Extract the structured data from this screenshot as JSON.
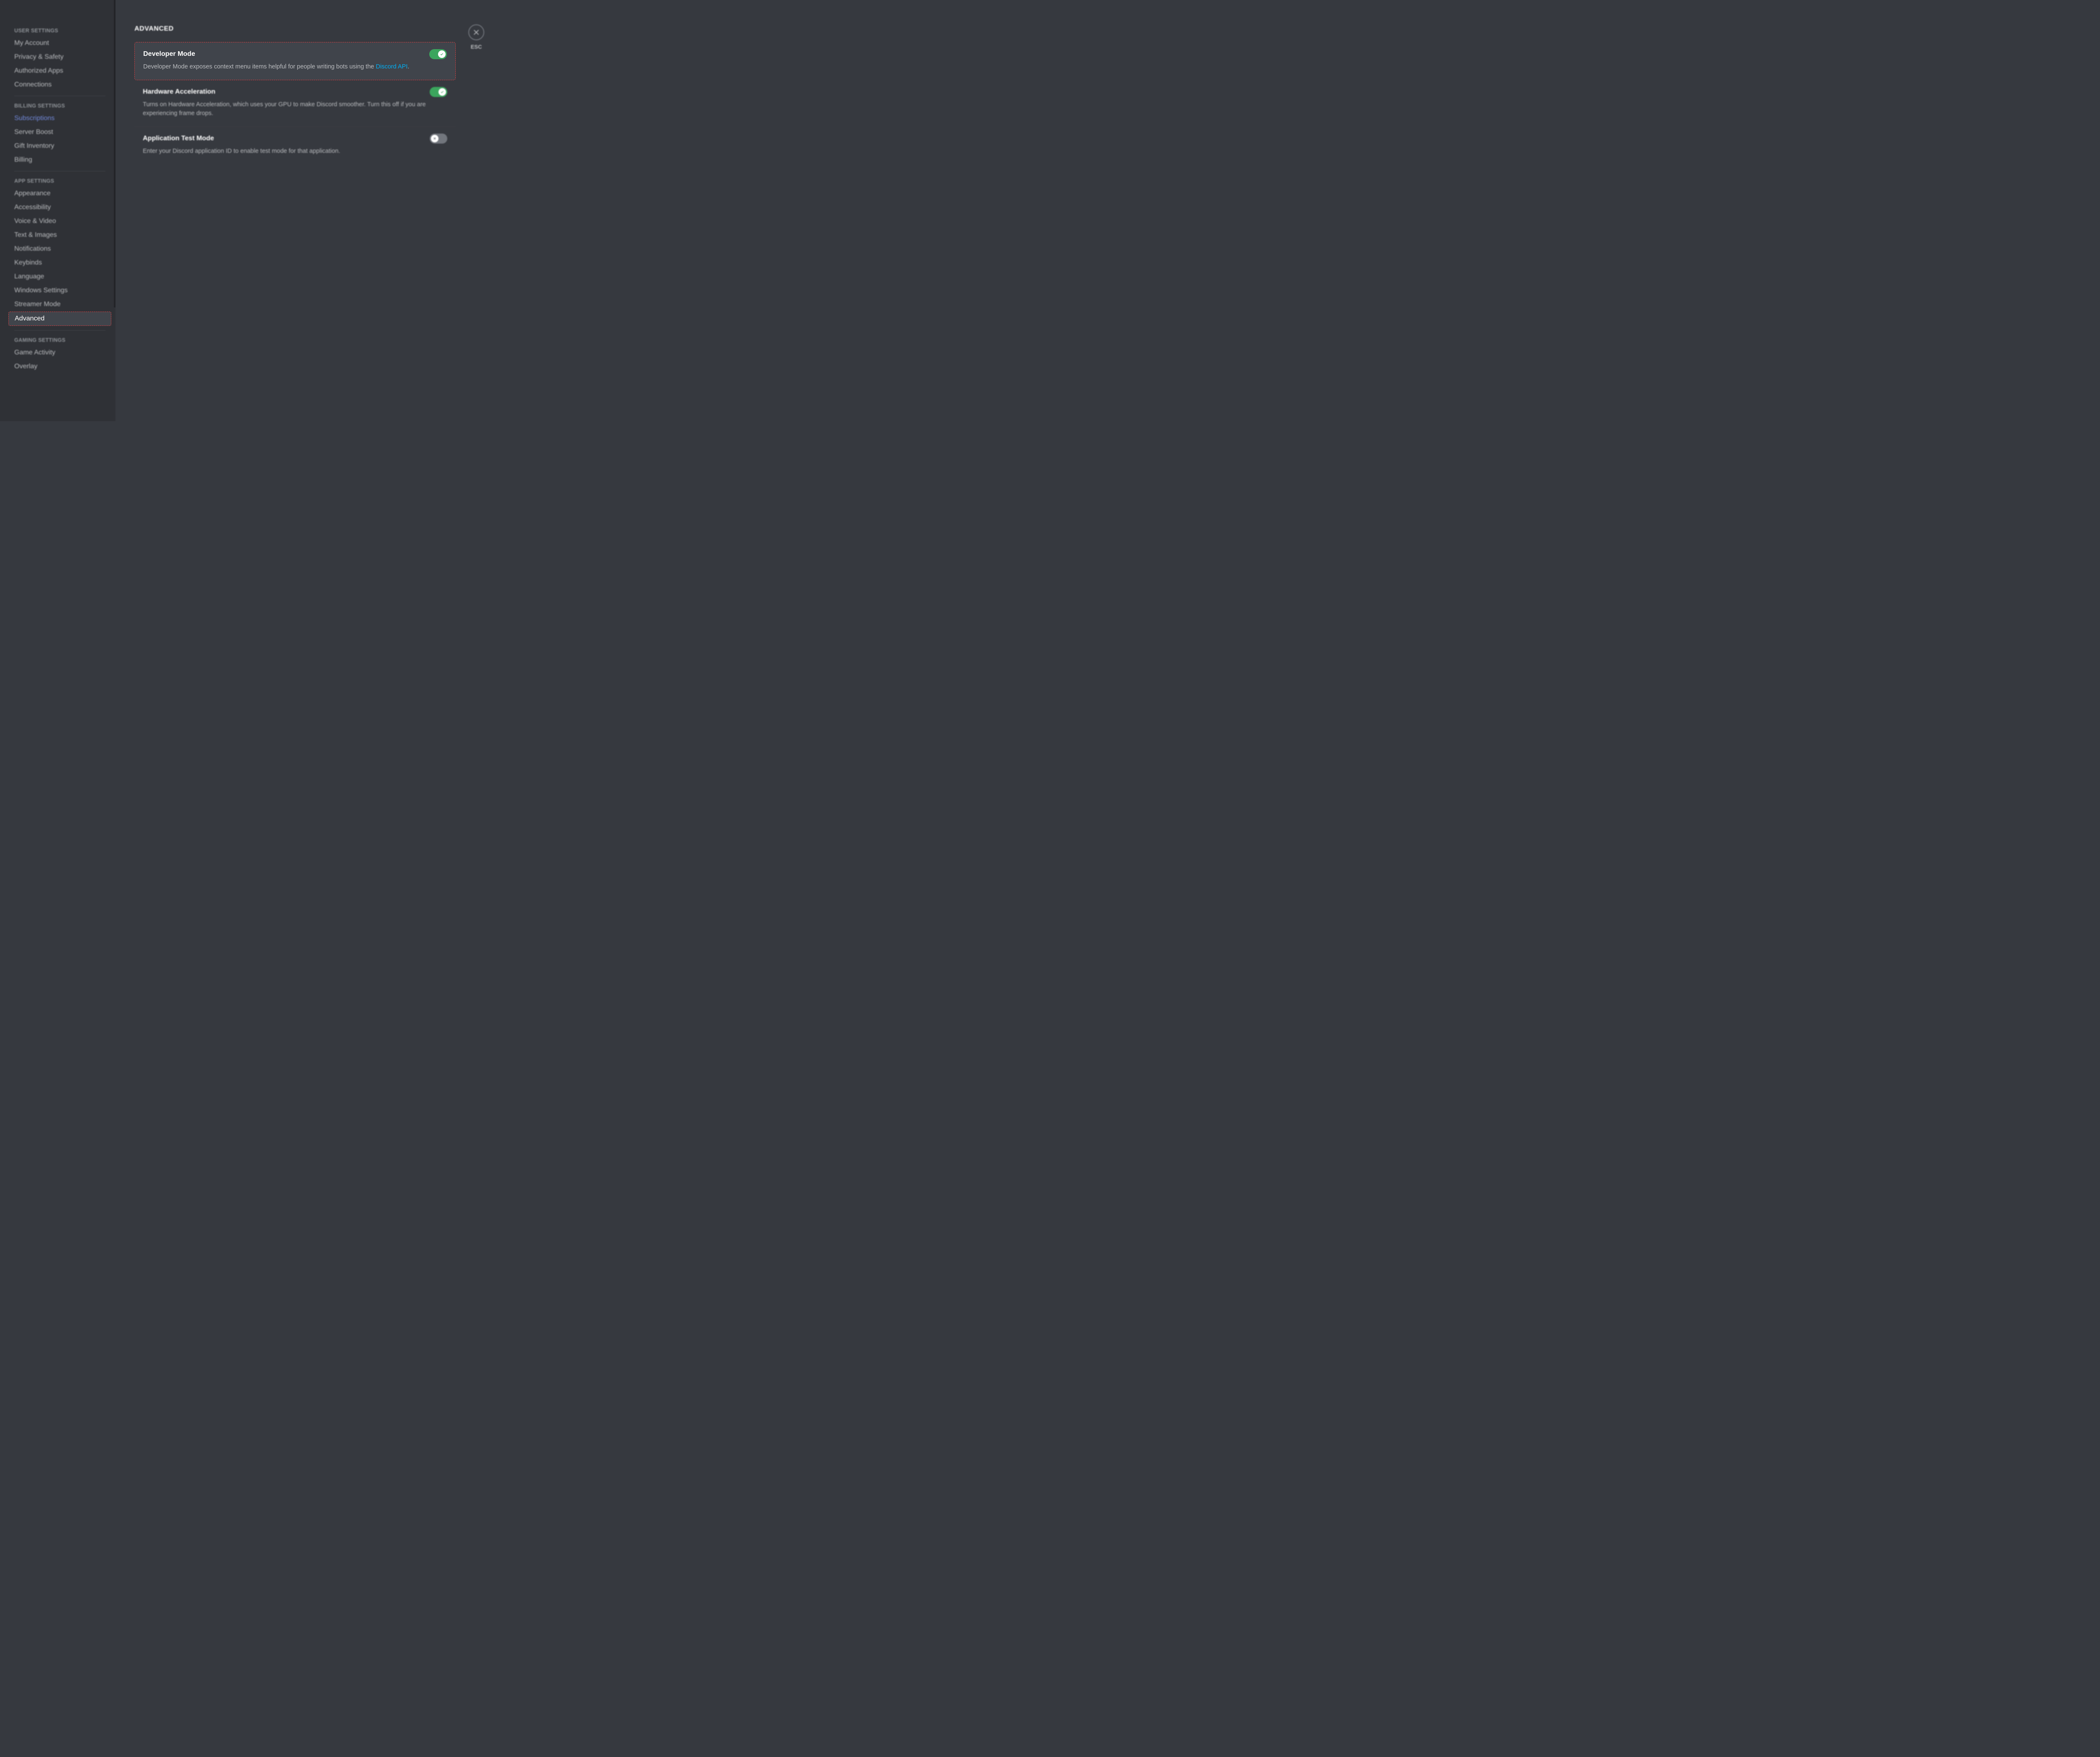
{
  "sidebar": {
    "sections": [
      {
        "header": "USER SETTINGS",
        "items": [
          {
            "label": "My Account",
            "key": "my-account"
          },
          {
            "label": "Privacy & Safety",
            "key": "privacy-safety"
          },
          {
            "label": "Authorized Apps",
            "key": "authorized-apps"
          },
          {
            "label": "Connections",
            "key": "connections"
          }
        ]
      },
      {
        "header": "BILLING SETTINGS",
        "items": [
          {
            "label": "Subscriptions",
            "key": "subscriptions",
            "highlighted": true
          },
          {
            "label": "Server Boost",
            "key": "server-boost"
          },
          {
            "label": "Gift Inventory",
            "key": "gift-inventory"
          },
          {
            "label": "Billing",
            "key": "billing"
          }
        ]
      },
      {
        "header": "APP SETTINGS",
        "items": [
          {
            "label": "Appearance",
            "key": "appearance"
          },
          {
            "label": "Accessibility",
            "key": "accessibility"
          },
          {
            "label": "Voice & Video",
            "key": "voice-video"
          },
          {
            "label": "Text & Images",
            "key": "text-images"
          },
          {
            "label": "Notifications",
            "key": "notifications"
          },
          {
            "label": "Keybinds",
            "key": "keybinds"
          },
          {
            "label": "Language",
            "key": "language"
          },
          {
            "label": "Windows Settings",
            "key": "windows-settings"
          },
          {
            "label": "Streamer Mode",
            "key": "streamer-mode"
          },
          {
            "label": "Advanced",
            "key": "advanced",
            "active": true
          }
        ]
      },
      {
        "header": "GAMING SETTINGS",
        "items": [
          {
            "label": "Game Activity",
            "key": "game-activity"
          },
          {
            "label": "Overlay",
            "key": "overlay"
          }
        ]
      }
    ]
  },
  "close": {
    "label": "ESC"
  },
  "main": {
    "title": "ADVANCED",
    "settings": [
      {
        "key": "developer-mode",
        "title": "Developer Mode",
        "desc_pre": "Developer Mode exposes context menu items helpful for people writing bots using the ",
        "link_text": "Discord API",
        "desc_post": ".",
        "state": "on",
        "emphasis": true
      },
      {
        "key": "hardware-acceleration",
        "title": "Hardware Acceleration",
        "desc": "Turns on Hardware Acceleration, which uses your GPU to make Discord smoother. Turn this off if you are experiencing frame drops.",
        "state": "on"
      },
      {
        "key": "application-test-mode",
        "title": "Application Test Mode",
        "desc": "Enter your Discord application ID to enable test mode for that application.",
        "state": "off"
      }
    ]
  }
}
